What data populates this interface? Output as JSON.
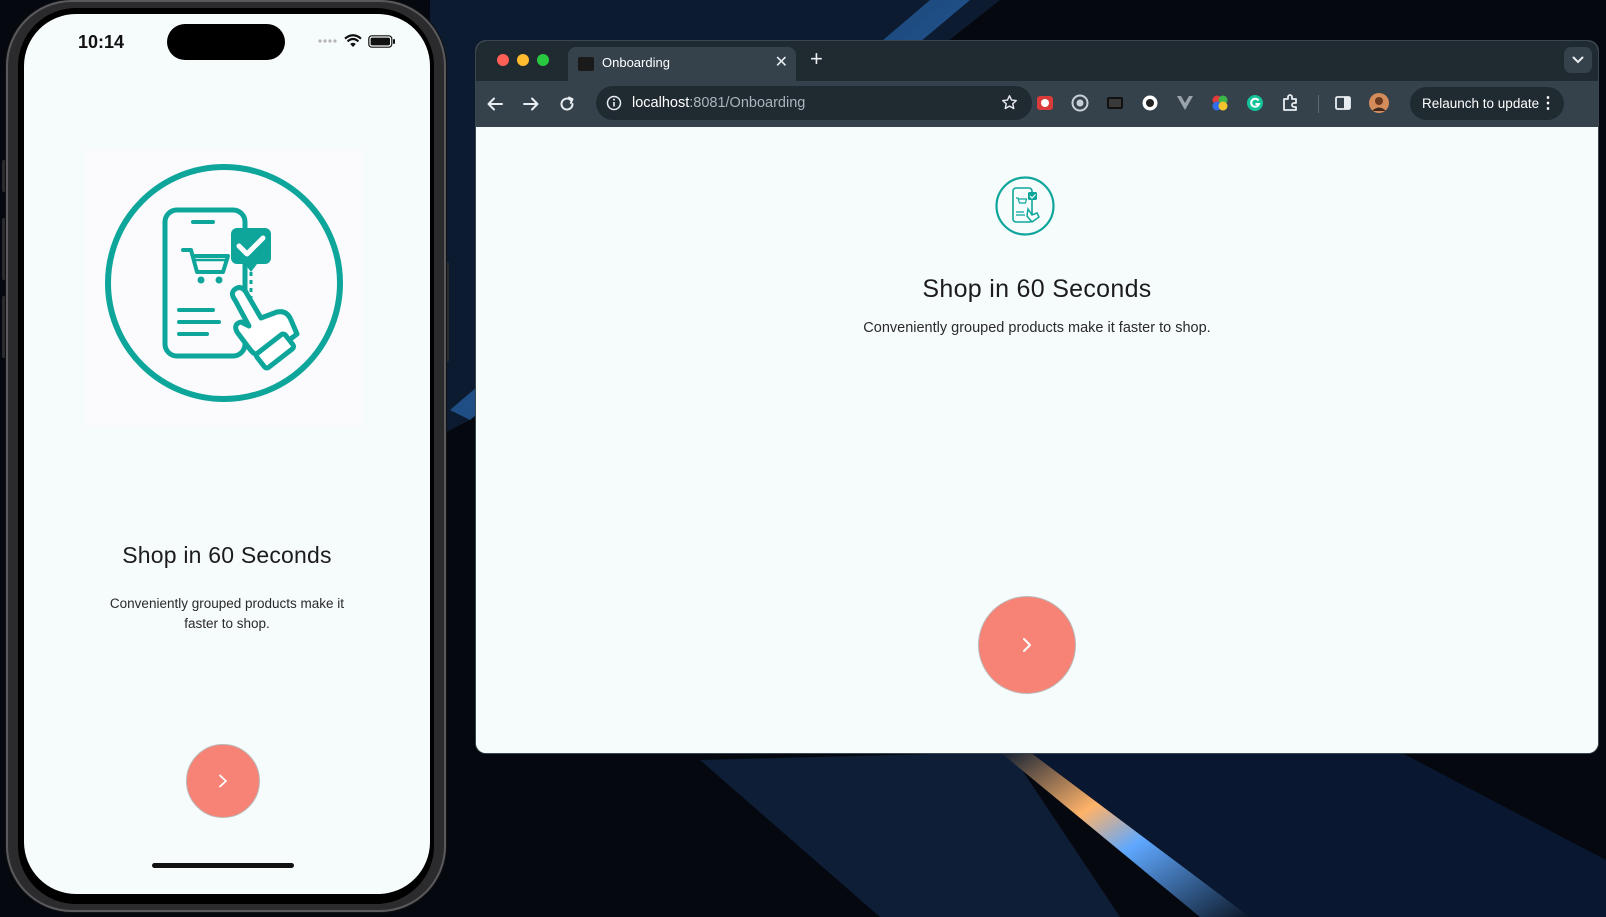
{
  "phone": {
    "status_time": "10:14",
    "title": "Shop in 60 Seconds",
    "description": "Conveniently grouped products make it faster to shop."
  },
  "browser": {
    "tab_title": "Onboarding",
    "url_host": "localhost",
    "url_rest": ":8081/Onboarding",
    "relaunch_label": "Relaunch to update",
    "page": {
      "title": "Shop in 60 Seconds",
      "description": "Conveniently grouped products make it faster to shop."
    }
  },
  "colors": {
    "accent_teal": "#0ea69b",
    "next_button": "#f68375",
    "page_bg": "#f6fbfc",
    "browser_chrome": "#35424c"
  },
  "icons": [
    "shopping-phone-illustration",
    "chevron-right-icon",
    "wifi-icon",
    "battery-icon",
    "back-icon",
    "forward-icon",
    "reload-icon",
    "site-info-icon",
    "star-icon",
    "close-icon",
    "plus-icon",
    "chevron-down-icon",
    "extensions-icon",
    "sidebar-icon",
    "profile-avatar",
    "kebab-menu-icon"
  ]
}
